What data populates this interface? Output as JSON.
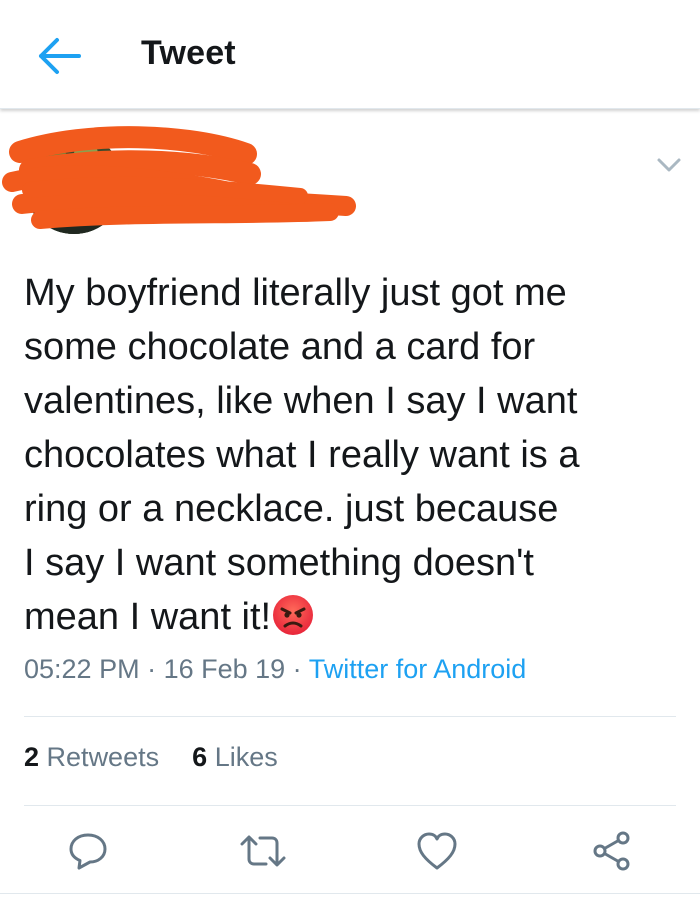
{
  "header": {
    "title": "Tweet",
    "back_icon": "back-arrow-icon"
  },
  "tweet": {
    "text": "My boyfriend literally just got me\nsome chocolate and a card for\nvalentines, like when I say I want\nchocolates what I really want is a\nring or a necklace. just because\nI say I want something doesn't\nmean I want it!",
    "emoji": "angry-face-emoji",
    "time": "05:22 PM",
    "date": "16 Feb 19",
    "separator": " · ",
    "source": "Twitter for Android"
  },
  "stats": {
    "retweets_count": "2",
    "retweets_label": "Retweets",
    "likes_count": "6",
    "likes_label": "Likes"
  },
  "actions": [
    "reply-icon",
    "retweet-icon",
    "like-icon",
    "share-icon"
  ],
  "colors": {
    "accent": "#1da1f2",
    "text": "#14171a",
    "secondary": "#657786",
    "redaction": "#f25a1d",
    "divider": "#e1e8ed"
  }
}
